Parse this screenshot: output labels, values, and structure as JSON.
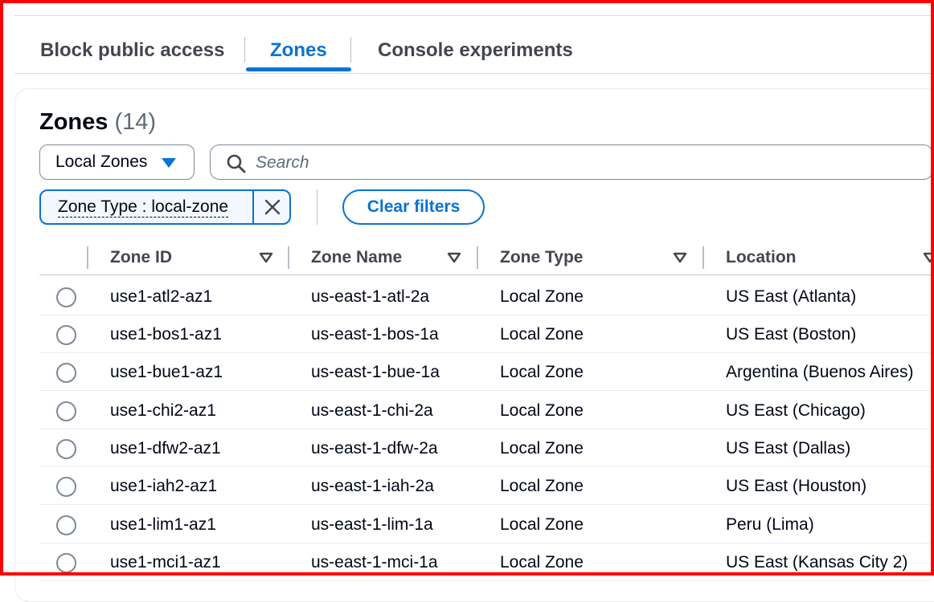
{
  "tabs": [
    {
      "label": "Block public access",
      "active": false
    },
    {
      "label": "Zones",
      "active": true
    },
    {
      "label": "Console experiments",
      "active": false
    }
  ],
  "header": {
    "title": "Zones",
    "count": "(14)"
  },
  "filter": {
    "dropdown_value": "Local Zones",
    "search_placeholder": "Search",
    "search_value": "",
    "token_label": "Zone Type : local-zone",
    "clear_label": "Clear filters"
  },
  "table": {
    "columns": [
      "Zone ID",
      "Zone Name",
      "Zone Type",
      "Location"
    ],
    "rows": [
      {
        "zone_id": "use1-atl2-az1",
        "zone_name": "us-east-1-atl-2a",
        "zone_type": "Local Zone",
        "location": "US East (Atlanta)"
      },
      {
        "zone_id": "use1-bos1-az1",
        "zone_name": "us-east-1-bos-1a",
        "zone_type": "Local Zone",
        "location": "US East (Boston)"
      },
      {
        "zone_id": "use1-bue1-az1",
        "zone_name": "us-east-1-bue-1a",
        "zone_type": "Local Zone",
        "location": "Argentina (Buenos Aires)"
      },
      {
        "zone_id": "use1-chi2-az1",
        "zone_name": "us-east-1-chi-2a",
        "zone_type": "Local Zone",
        "location": "US East (Chicago)"
      },
      {
        "zone_id": "use1-dfw2-az1",
        "zone_name": "us-east-1-dfw-2a",
        "zone_type": "Local Zone",
        "location": "US East (Dallas)"
      },
      {
        "zone_id": "use1-iah2-az1",
        "zone_name": "us-east-1-iah-2a",
        "zone_type": "Local Zone",
        "location": "US East (Houston)"
      },
      {
        "zone_id": "use1-lim1-az1",
        "zone_name": "us-east-1-lim-1a",
        "zone_type": "Local Zone",
        "location": "Peru (Lima)"
      },
      {
        "zone_id": "use1-mci1-az1",
        "zone_name": "us-east-1-mci-1a",
        "zone_type": "Local Zone",
        "location": "US East (Kansas City 2)"
      }
    ]
  },
  "colors": {
    "accent": "#0972d3",
    "text": "#000716",
    "muted": "#5f6b7a",
    "highlight_border": "#ff0000"
  },
  "icons": [
    "search-icon",
    "caret-down-icon",
    "close-icon",
    "sort-icon"
  ]
}
